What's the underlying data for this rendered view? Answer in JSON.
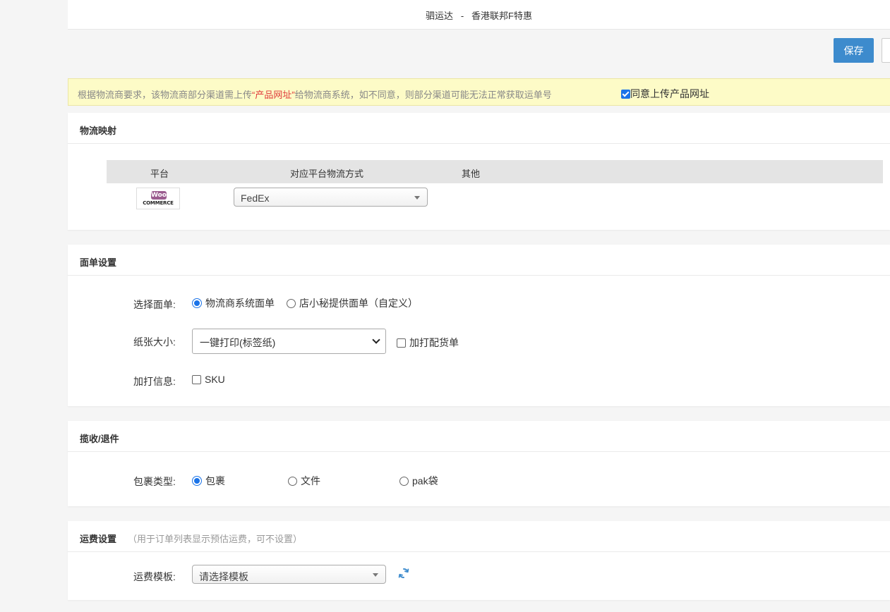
{
  "header": {
    "title": "驷运达   -   香港联邦F特惠"
  },
  "toolbar": {
    "save_label": "保存"
  },
  "notice": {
    "text_before": "根据物流商要求，该物流商部分渠道需上传",
    "text_highlight": "“产品网址”",
    "text_after": "给物流商系统，如不同意，则部分渠道可能无法正常获取运单号",
    "agree_label": "同意上传产品网址",
    "agree_checked": true
  },
  "mapping": {
    "title": "物流映射",
    "columns": [
      "平台",
      "对应平台物流方式",
      "其他"
    ],
    "rows": [
      {
        "platform_logo_badge": "Woo",
        "platform_logo_text": "COMMERCE",
        "shipping_method": "FedEx"
      }
    ]
  },
  "label_settings": {
    "title": "面单设置",
    "select_label": "选择面单:",
    "options": [
      "物流商系统面单",
      "店小秘提供面单（自定义）"
    ],
    "selected_option": 0,
    "paper_size_label": "纸张大小:",
    "paper_size_value": "一键打印(标签纸)",
    "print_packing_label": "加打配货单",
    "extra_info_label": "加打信息:",
    "extra_sku_label": "SKU"
  },
  "pickup": {
    "title": "揽收/退件",
    "package_type_label": "包裹类型:",
    "options": [
      "包裹",
      "文件",
      "pak袋"
    ],
    "selected_option": 0
  },
  "freight": {
    "title": "运费设置",
    "subtitle": "（用于订单列表显示预估运费，可不设置）",
    "template_label": "运费模板:",
    "template_placeholder": "请选择模板"
  },
  "colors": {
    "primary": "#3d8bcd",
    "notice_bg": "#fdfbc7",
    "highlight": "#e03b3b",
    "check_blue": "#1a73e8"
  },
  "icons": {
    "refresh": "refresh-icon"
  }
}
